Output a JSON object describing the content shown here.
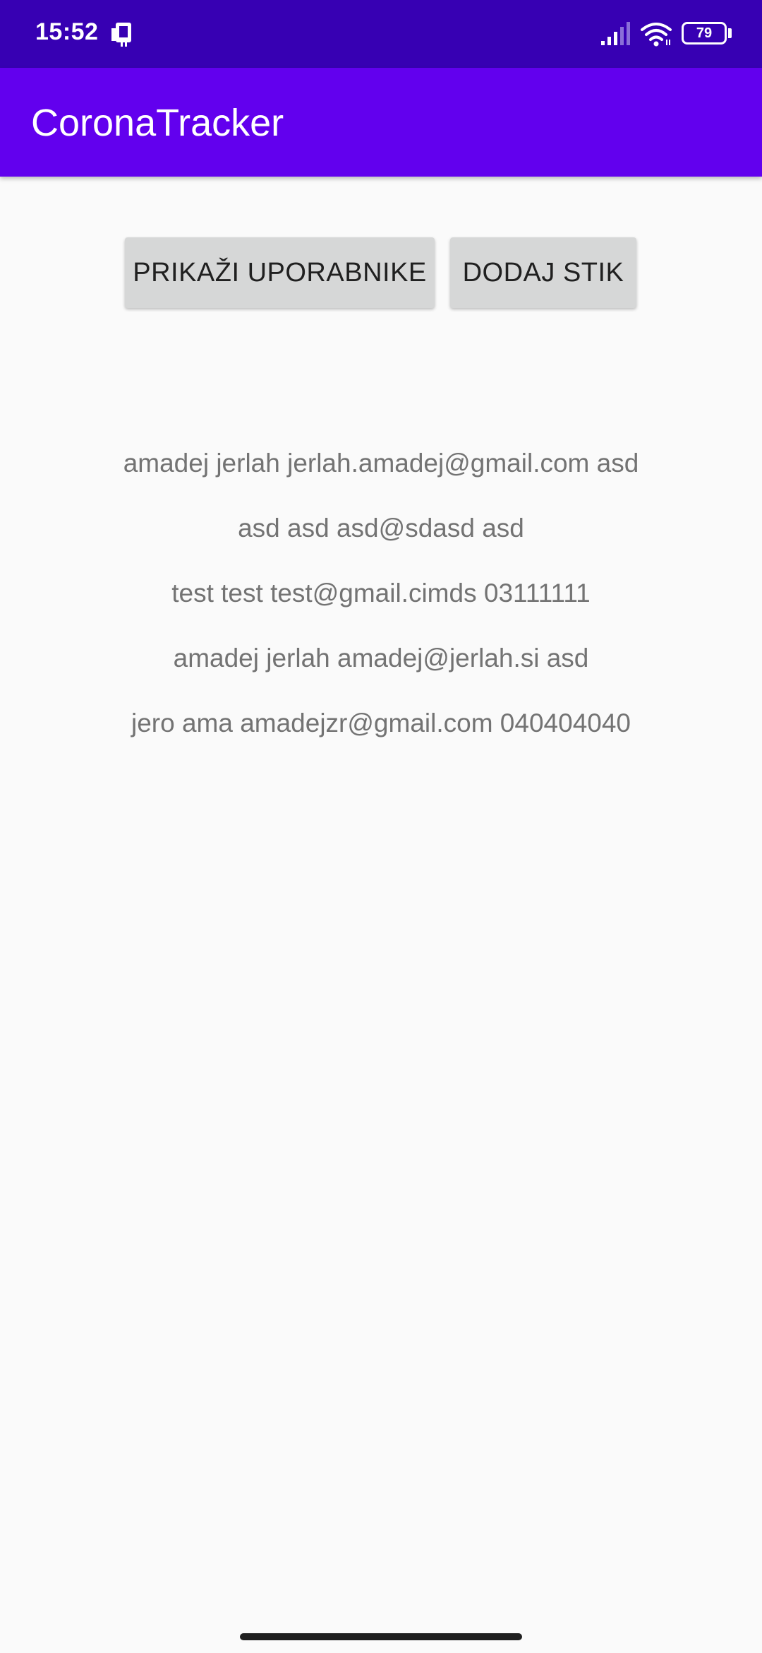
{
  "status_bar": {
    "time": "15:52",
    "battery_level": "79",
    "icons": [
      "notification-icon",
      "signal-icon",
      "wifi-icon",
      "battery-icon"
    ]
  },
  "app_bar": {
    "title": "CoronaTracker"
  },
  "actions": {
    "show_users_label": "PRIKAŽI UPORABNIKE",
    "add_contact_label": "DODAJ STIK"
  },
  "users": [
    "amadej jerlah jerlah.amadej@gmail.com asd",
    "asd asd asd@sdasd asd",
    "test test test@gmail.cimds 03111111",
    "amadej jerlah amadej@jerlah.si asd",
    "jero ama amadejzr@gmail.com 040404040"
  ],
  "colors": {
    "status_bar": "#3700b3",
    "app_bar": "#6200ee",
    "background": "#fafafa",
    "button": "#d6d7d7",
    "list_text": "#737373"
  }
}
